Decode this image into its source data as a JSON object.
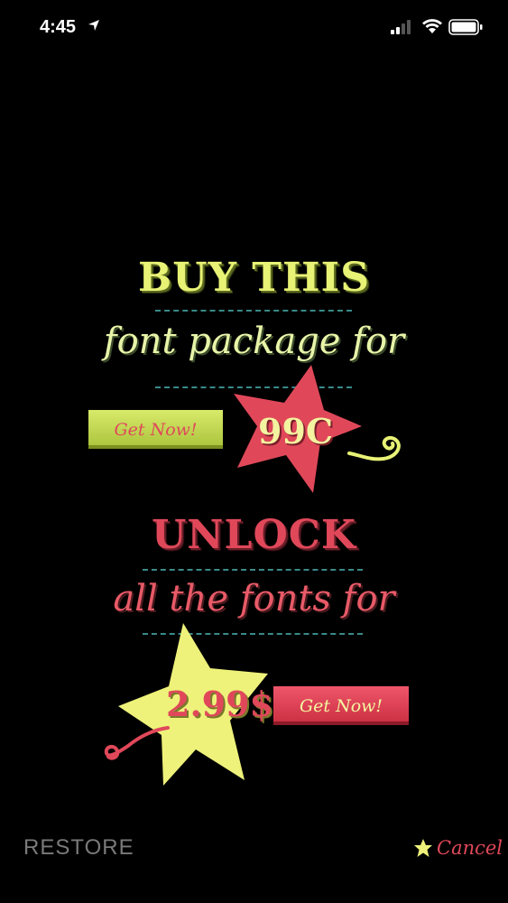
{
  "status_bar": {
    "time": "4:45"
  },
  "offer_one": {
    "title": "BUY THIS",
    "subtitle": "font package for",
    "price": "99C",
    "button_label": "Get Now!"
  },
  "offer_two": {
    "title": "UNLOCK",
    "subtitle": "all the fonts for",
    "price": "2.99$",
    "button_label": "Get Now!"
  },
  "footer": {
    "restore_label": "RESTORE",
    "cancel_label": "Cancel"
  },
  "colors": {
    "background": "#000000",
    "lime": "#e8f275",
    "coral": "#e0485a",
    "divider_teal": "#3a8a8a",
    "restore_gray": "#7a7a7a"
  },
  "icons": [
    "location-arrow-icon",
    "signal-icon",
    "wifi-icon",
    "battery-icon",
    "star-icon",
    "heart-icon",
    "swirl-icon"
  ]
}
